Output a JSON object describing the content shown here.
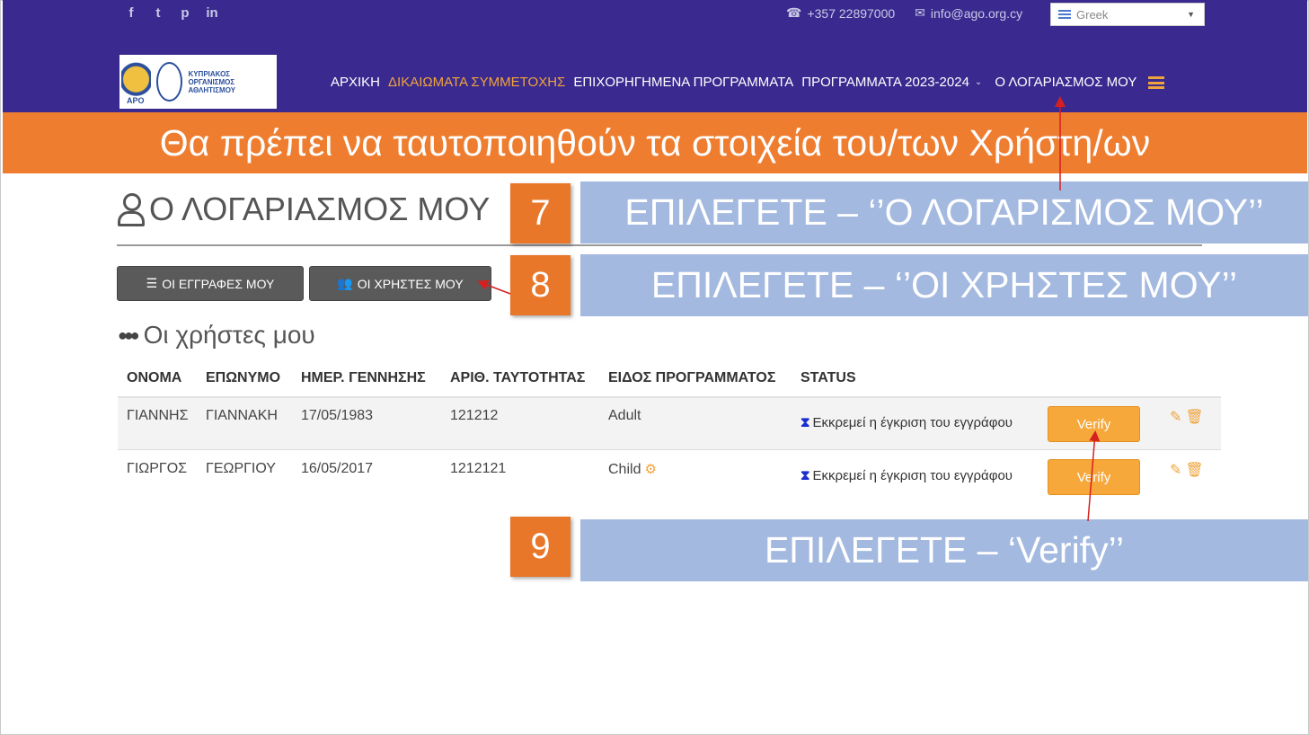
{
  "header": {
    "social": [
      "f",
      "t",
      "p",
      "in"
    ],
    "phone": "+357 22897000",
    "email": "info@ago.org.cy",
    "language": "Greek",
    "logo_text": "ΚΥΠΡΙΑΚΟΣ ΟΡΓΑΝΙΣΜΟΣ ΑΘΛΗΤΙΣΜΟΥ",
    "logo_badge": "ΑΡΟ",
    "nav": {
      "home": "ΑΡΧΙΚΗ",
      "rights": "ΔΙΚΑΙΩΜΑΤΑ ΣΥΜΜΕΤΟΧΗΣ",
      "funded": "ΕΠΙΧΟΡΗΓΗΜΕΝΑ ΠΡΟΓΡΑΜΜΑΤΑ",
      "programs": "ΠΡΟΓΡΑΜΜΑΤΑ 2023-2024",
      "account": "Ο ΛΟΓΑΡΙΑΣΜΟΣ ΜΟΥ"
    }
  },
  "banner": "Θα πρέπει να ταυτοποιηθούν τα στοιχεία του/των Χρήστη/ων",
  "page": {
    "title": "Ο ΛΟΓΑΡΙΑΣΜΟΣ ΜΟΥ",
    "btn_registrations": "ΟΙ ΕΓΓΡΑΦΕΣ ΜΟΥ",
    "btn_users": "ΟΙ ΧΡΗΣΤΕΣ ΜΟΥ",
    "users_heading": "Οι χρήστες μου"
  },
  "table": {
    "headers": [
      "ΟΝΟΜΑ",
      "ΕΠΩΝΥΜΟ",
      "ΗΜΕΡ. ΓΕΝΝΗΣΗΣ",
      "ΑΡΙΘ. ΤΑΥΤΟΤΗΤΑΣ",
      "ΕΙΔΟΣ ΠΡΟΓΡΑΜΜΑΤΟΣ",
      "STATUS"
    ],
    "rows": [
      {
        "first": "ΓΙΑΝΝΗΣ",
        "last": "ΓΙΑΝΝΑΚΗ",
        "dob": "17/05/1983",
        "id": "121212",
        "program": "Adult",
        "status": "Εκκρεμεί η έγκριση του εγγράφου",
        "action": "Verify"
      },
      {
        "first": "ΓΙΩΡΓΟΣ",
        "last": "ΓΕΩΡΓΙΟΥ",
        "dob": "16/05/2017",
        "id": "1212121",
        "program": "Child",
        "status": "Εκκρεμεί η έγκριση του εγγράφου",
        "action": "Verify"
      }
    ]
  },
  "steps": [
    {
      "num": "7",
      "text": "ΕΠΙΛΕΓΕΤΕ – ‘’Ο ΛΟΓΑΡΙΣΜΟΣ ΜΟΥ’’"
    },
    {
      "num": "8",
      "text": "ΕΠΙΛΕΓΕΤΕ – ‘’ΟΙ ΧΡΗΣΤΕΣ ΜΟΥ’’"
    },
    {
      "num": "9",
      "text": "ΕΠΙΛΕΓΕΤΕ – ‘Verify’’"
    }
  ],
  "colors": {
    "header": "#3a2a8f",
    "banner": "#ee7d30",
    "callout": "#a3b9e0",
    "accent": "#f0a33c",
    "verify": "#f7a83b"
  }
}
